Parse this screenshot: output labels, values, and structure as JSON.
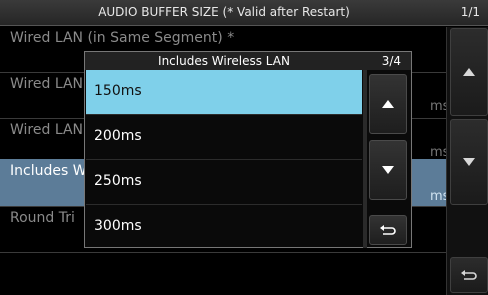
{
  "header": {
    "title": "AUDIO BUFFER SIZE (* Valid after Restart)",
    "page": "1/1"
  },
  "list": {
    "items": [
      {
        "label": "Wired LAN (in Same Segment) *",
        "value": ""
      },
      {
        "label": "Wired LAN",
        "value": "ms"
      },
      {
        "label": "Wired LAN",
        "value": "ms"
      },
      {
        "label": "Includes W",
        "value": "ms",
        "selected": true
      },
      {
        "label": "Round Tri",
        "value": ""
      }
    ]
  },
  "popup": {
    "title": "Includes Wireless LAN",
    "page": "3/4",
    "options": [
      {
        "label": "150ms",
        "active": true
      },
      {
        "label": "200ms"
      },
      {
        "label": "250ms"
      },
      {
        "label": "300ms"
      }
    ]
  },
  "icons": {
    "up": "triangle-up-icon",
    "down": "triangle-down-icon",
    "back": "return-arrow-icon"
  },
  "colors": {
    "selected_option": "#7fd0ea",
    "selected_row": "#5c7c98"
  }
}
